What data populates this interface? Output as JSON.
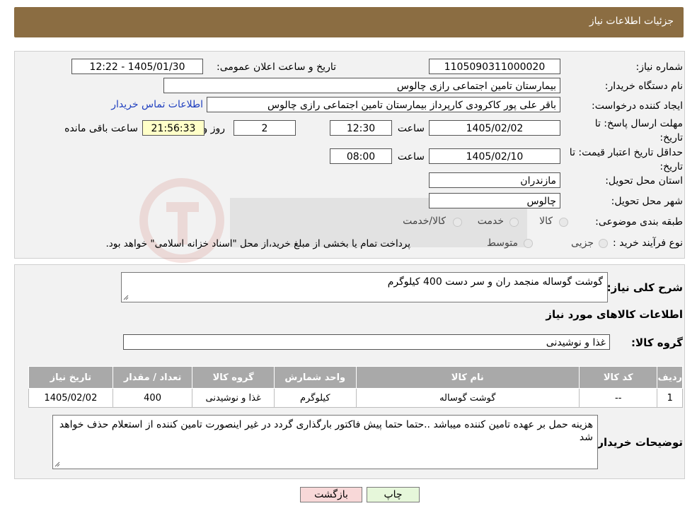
{
  "header": {
    "title": "جزئیات اطلاعات نیاز"
  },
  "form": {
    "need_number_label": "شماره نیاز:",
    "need_number": "1105090311000020",
    "announce_label": "تاریخ و ساعت اعلان عمومی:",
    "announce_value": "1405/01/30 - 12:22",
    "buyer_org_label": "نام دستگاه خریدار:",
    "buyer_org": "بیمارستان تامین اجتماعی رازی چالوس",
    "creator_label": "ایجاد کننده درخواست:",
    "creator": "باقر علی پور کاکرودی کارپرداز بیمارستان تامین اجتماعی رازی چالوس",
    "contact_link": "اطلاعات تماس خریدار",
    "deadline_label": "مهلت ارسال پاسخ: تا تاریخ:",
    "deadline_date": "1405/02/02",
    "time_label": "ساعت",
    "deadline_time": "12:30",
    "days_value": "2",
    "days_label": "روز و",
    "remaining_time": "21:56:33",
    "remaining_label": "ساعت باقی مانده",
    "min_validity_label": "حداقل تاریخ اعتبار قیمت: تا تاریخ:",
    "validity_date": "1405/02/10",
    "validity_time": "08:00",
    "province_label": "استان محل تحویل:",
    "province": "مازندران",
    "city_label": "شهر محل تحویل:",
    "city": "چالوس",
    "category_label": "طبقه بندی موضوعی:",
    "category_options": [
      "کالا",
      "خدمت",
      "کالا/خدمت"
    ],
    "process_label": "نوع فرآیند خرید :",
    "process_options": [
      "جزیی",
      "متوسط"
    ],
    "process_note": "پرداخت تمام یا بخشی از مبلغ خرید،از محل \"اسناد خزانه اسلامی\" خواهد بود."
  },
  "details": {
    "summary_label": "شرح کلی نیاز:",
    "summary": "گوشت گوساله منجمد ران و سر دست 400 کیلوگرم",
    "items_title": "اطلاعات کالاهای مورد نیاز",
    "group_label": "گروه کالا:",
    "group_value": "غذا و نوشیدنی",
    "table": {
      "headers": [
        "ردیف",
        "کد کالا",
        "نام کالا",
        "واحد شمارش",
        "گروه کالا",
        "تعداد / مقدار",
        "تاریخ نیاز"
      ],
      "rows": [
        [
          "1",
          "--",
          "گوشت گوساله",
          "کیلوگرم",
          "غذا و نوشیدنی",
          "400",
          "1405/02/02"
        ]
      ]
    },
    "buyer_notes_label": "توضیحات خریدار:",
    "buyer_notes": "هزینه حمل بر عهده تامین کننده میباشد ..حتما حتما پیش فاکتور بارگذاری گردد در غیر اینصورت تامین کننده از استعلام حذف خواهد شد"
  },
  "buttons": {
    "print": "چاپ",
    "back": "بازگشت"
  },
  "colors": {
    "header": "#8b6d42",
    "table_header": "#a9a9a9",
    "remaining_bg": "#ffffc8",
    "back_button": "#f8d8d8",
    "print_button": "#e6f7da"
  }
}
